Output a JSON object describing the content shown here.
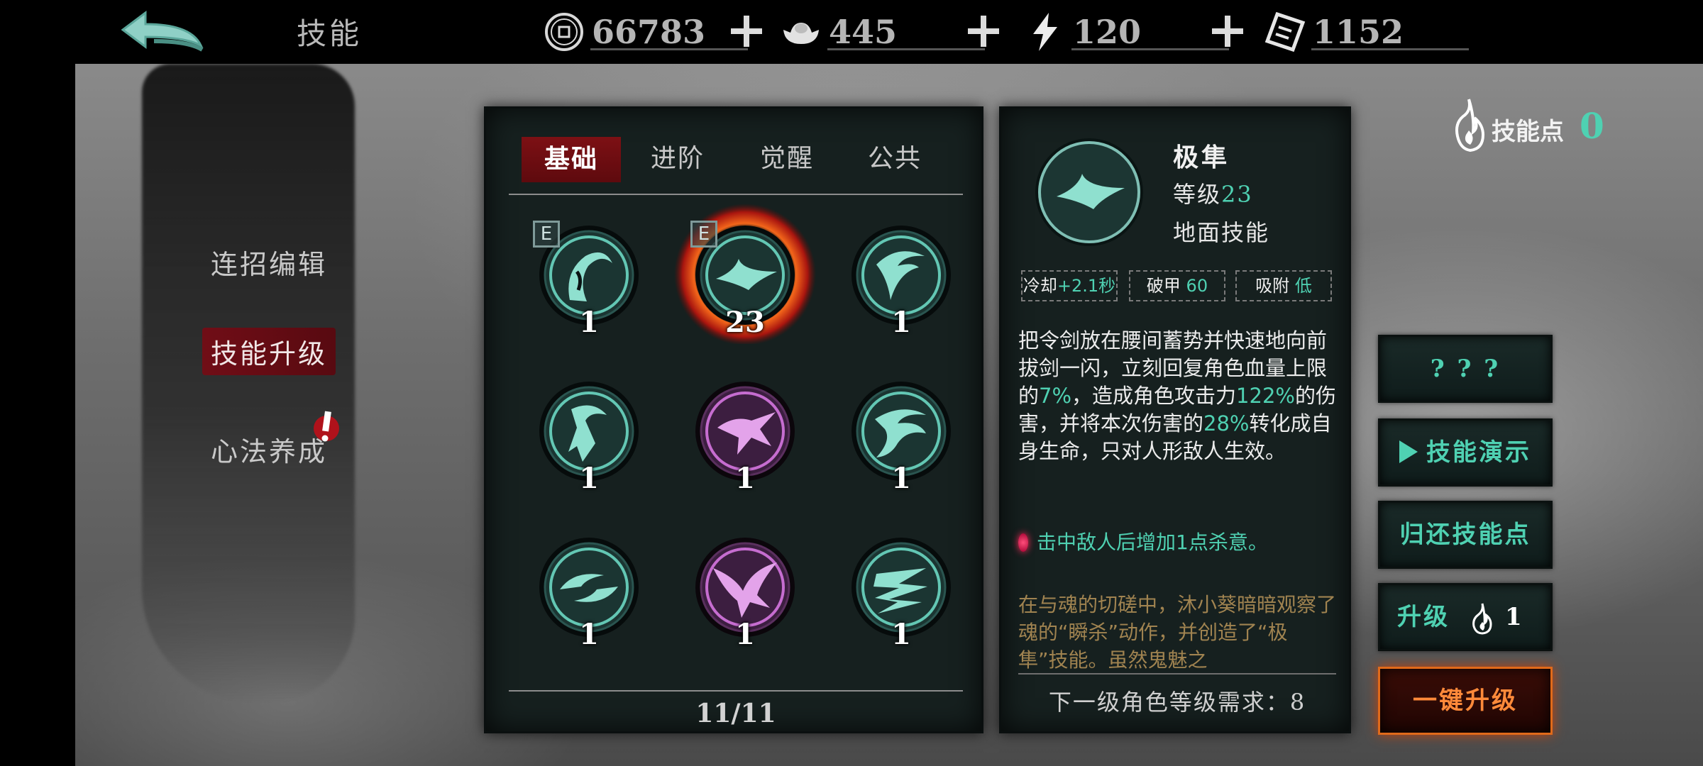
{
  "topbar": {
    "title": "技能",
    "back_icon": "back-arrow-icon",
    "currencies": [
      {
        "id": "coins",
        "icon": "coin-icon",
        "value": "66783"
      },
      {
        "id": "ingots",
        "icon": "ingot-icon",
        "value": "445"
      },
      {
        "id": "energy",
        "icon": "lightning-icon",
        "value": "120"
      },
      {
        "id": "tickets",
        "icon": "ticket-icon",
        "value": "1152"
      }
    ]
  },
  "sidebar": {
    "items": [
      {
        "label": "连招编辑",
        "active": false
      },
      {
        "label": "技能升级",
        "active": true
      },
      {
        "label": "心法养成",
        "active": false,
        "alert": true
      }
    ]
  },
  "tabs": [
    {
      "label": "基础",
      "active": true
    },
    {
      "label": "进阶",
      "active": false
    },
    {
      "label": "觉醒",
      "active": false
    },
    {
      "label": "公共",
      "active": false
    }
  ],
  "skills": [
    {
      "level": "1",
      "badge": "E",
      "theme": "teal",
      "icon": "slash-skill-icon"
    },
    {
      "level": "23",
      "badge": "E",
      "theme": "teal",
      "selected": true,
      "icon": "swift-swallow-skill-icon"
    },
    {
      "level": "1",
      "theme": "teal",
      "icon": "spin-slash-skill-icon"
    },
    {
      "level": "1",
      "theme": "teal",
      "icon": "rising-blade-skill-icon"
    },
    {
      "level": "1",
      "theme": "purple",
      "icon": "leaping-strike-skill-icon"
    },
    {
      "level": "1",
      "theme": "teal",
      "icon": "wave-slash-skill-icon"
    },
    {
      "level": "1",
      "theme": "teal",
      "icon": "crescent-skill-icon"
    },
    {
      "level": "1",
      "theme": "purple",
      "icon": "falcon-skill-icon"
    },
    {
      "level": "1",
      "theme": "teal",
      "icon": "whirlwind-skill-icon"
    }
  ],
  "page_indicator": "11/11",
  "detail": {
    "name": "极隼",
    "level_label": "等级",
    "level_value": "23",
    "type": "地面技能",
    "stats": [
      {
        "label": "冷却",
        "value": "+2.1秒"
      },
      {
        "label": "破甲",
        "value": "60"
      },
      {
        "label": "吸附",
        "value": "低"
      }
    ],
    "description": [
      {
        "text": "把令剑放在腰间蓄势并快速地向前拔剑一闪，立刻回复角色血量上限的",
        "hl": false
      },
      {
        "text": "7%",
        "hl": true
      },
      {
        "text": "，造成角色攻击力",
        "hl": false
      },
      {
        "text": "122%",
        "hl": true
      },
      {
        "text": "的伤害，并将本次伤害的",
        "hl": false
      },
      {
        "text": "28%",
        "hl": true
      },
      {
        "text": "转化成自身生命，只对人形敌人生效。",
        "hl": false
      }
    ],
    "bonus": "击中敌人后增加1点杀意。",
    "lore": "在与魂的切磋中，沐小葵暗暗观察了魂的“瞬杀”动作，并创造了“极隼”技能。虽然鬼魅之",
    "next_requirement": "下一级角色等级需求：8"
  },
  "skill_points": {
    "label": "技能点",
    "value": "0"
  },
  "actions": {
    "unknown": "? ? ?",
    "demo": "技能演示",
    "refund": "归还技能点",
    "upgrade_label": "升级",
    "upgrade_cost": "1",
    "upgrade_all": "一键升级"
  },
  "colors": {
    "accent_teal": "#4fd1b2",
    "tab_active_red": "#7d1014",
    "lore_gold": "#a08350",
    "upgrade_orange": "#e06a1a",
    "purple_orb": "#d06ad9"
  }
}
